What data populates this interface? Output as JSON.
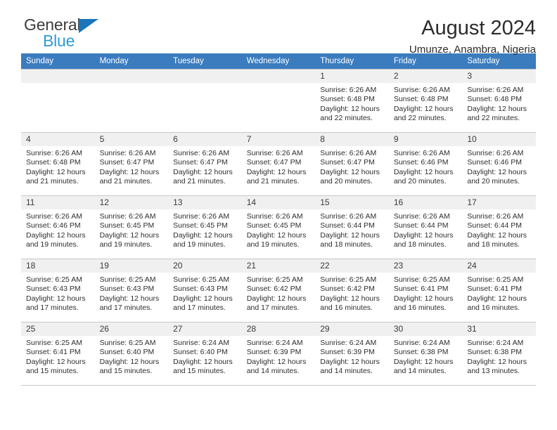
{
  "brand": {
    "name_top": "General",
    "name_bottom": "Blue",
    "accent_color": "#1b75bb",
    "accent_color_light": "#2e9bd6"
  },
  "header": {
    "title": "August 2024",
    "location": "Umunze, Anambra, Nigeria"
  },
  "calendar": {
    "header_bg": "#3b7cbf",
    "header_text_color": "#ffffff",
    "daynum_bg": "#f0f0f0",
    "weekdays": [
      "Sunday",
      "Monday",
      "Tuesday",
      "Wednesday",
      "Thursday",
      "Friday",
      "Saturday"
    ],
    "weeks": [
      [
        {
          "day": "",
          "sunrise": "",
          "sunset": "",
          "daylight_line1": "",
          "daylight_line2": ""
        },
        {
          "day": "",
          "sunrise": "",
          "sunset": "",
          "daylight_line1": "",
          "daylight_line2": ""
        },
        {
          "day": "",
          "sunrise": "",
          "sunset": "",
          "daylight_line1": "",
          "daylight_line2": ""
        },
        {
          "day": "",
          "sunrise": "",
          "sunset": "",
          "daylight_line1": "",
          "daylight_line2": ""
        },
        {
          "day": "1",
          "sunrise": "Sunrise: 6:26 AM",
          "sunset": "Sunset: 6:48 PM",
          "daylight_line1": "Daylight: 12 hours",
          "daylight_line2": "and 22 minutes."
        },
        {
          "day": "2",
          "sunrise": "Sunrise: 6:26 AM",
          "sunset": "Sunset: 6:48 PM",
          "daylight_line1": "Daylight: 12 hours",
          "daylight_line2": "and 22 minutes."
        },
        {
          "day": "3",
          "sunrise": "Sunrise: 6:26 AM",
          "sunset": "Sunset: 6:48 PM",
          "daylight_line1": "Daylight: 12 hours",
          "daylight_line2": "and 22 minutes."
        }
      ],
      [
        {
          "day": "4",
          "sunrise": "Sunrise: 6:26 AM",
          "sunset": "Sunset: 6:48 PM",
          "daylight_line1": "Daylight: 12 hours",
          "daylight_line2": "and 21 minutes."
        },
        {
          "day": "5",
          "sunrise": "Sunrise: 6:26 AM",
          "sunset": "Sunset: 6:47 PM",
          "daylight_line1": "Daylight: 12 hours",
          "daylight_line2": "and 21 minutes."
        },
        {
          "day": "6",
          "sunrise": "Sunrise: 6:26 AM",
          "sunset": "Sunset: 6:47 PM",
          "daylight_line1": "Daylight: 12 hours",
          "daylight_line2": "and 21 minutes."
        },
        {
          "day": "7",
          "sunrise": "Sunrise: 6:26 AM",
          "sunset": "Sunset: 6:47 PM",
          "daylight_line1": "Daylight: 12 hours",
          "daylight_line2": "and 21 minutes."
        },
        {
          "day": "8",
          "sunrise": "Sunrise: 6:26 AM",
          "sunset": "Sunset: 6:47 PM",
          "daylight_line1": "Daylight: 12 hours",
          "daylight_line2": "and 20 minutes."
        },
        {
          "day": "9",
          "sunrise": "Sunrise: 6:26 AM",
          "sunset": "Sunset: 6:46 PM",
          "daylight_line1": "Daylight: 12 hours",
          "daylight_line2": "and 20 minutes."
        },
        {
          "day": "10",
          "sunrise": "Sunrise: 6:26 AM",
          "sunset": "Sunset: 6:46 PM",
          "daylight_line1": "Daylight: 12 hours",
          "daylight_line2": "and 20 minutes."
        }
      ],
      [
        {
          "day": "11",
          "sunrise": "Sunrise: 6:26 AM",
          "sunset": "Sunset: 6:46 PM",
          "daylight_line1": "Daylight: 12 hours",
          "daylight_line2": "and 19 minutes."
        },
        {
          "day": "12",
          "sunrise": "Sunrise: 6:26 AM",
          "sunset": "Sunset: 6:45 PM",
          "daylight_line1": "Daylight: 12 hours",
          "daylight_line2": "and 19 minutes."
        },
        {
          "day": "13",
          "sunrise": "Sunrise: 6:26 AM",
          "sunset": "Sunset: 6:45 PM",
          "daylight_line1": "Daylight: 12 hours",
          "daylight_line2": "and 19 minutes."
        },
        {
          "day": "14",
          "sunrise": "Sunrise: 6:26 AM",
          "sunset": "Sunset: 6:45 PM",
          "daylight_line1": "Daylight: 12 hours",
          "daylight_line2": "and 19 minutes."
        },
        {
          "day": "15",
          "sunrise": "Sunrise: 6:26 AM",
          "sunset": "Sunset: 6:44 PM",
          "daylight_line1": "Daylight: 12 hours",
          "daylight_line2": "and 18 minutes."
        },
        {
          "day": "16",
          "sunrise": "Sunrise: 6:26 AM",
          "sunset": "Sunset: 6:44 PM",
          "daylight_line1": "Daylight: 12 hours",
          "daylight_line2": "and 18 minutes."
        },
        {
          "day": "17",
          "sunrise": "Sunrise: 6:26 AM",
          "sunset": "Sunset: 6:44 PM",
          "daylight_line1": "Daylight: 12 hours",
          "daylight_line2": "and 18 minutes."
        }
      ],
      [
        {
          "day": "18",
          "sunrise": "Sunrise: 6:25 AM",
          "sunset": "Sunset: 6:43 PM",
          "daylight_line1": "Daylight: 12 hours",
          "daylight_line2": "and 17 minutes."
        },
        {
          "day": "19",
          "sunrise": "Sunrise: 6:25 AM",
          "sunset": "Sunset: 6:43 PM",
          "daylight_line1": "Daylight: 12 hours",
          "daylight_line2": "and 17 minutes."
        },
        {
          "day": "20",
          "sunrise": "Sunrise: 6:25 AM",
          "sunset": "Sunset: 6:43 PM",
          "daylight_line1": "Daylight: 12 hours",
          "daylight_line2": "and 17 minutes."
        },
        {
          "day": "21",
          "sunrise": "Sunrise: 6:25 AM",
          "sunset": "Sunset: 6:42 PM",
          "daylight_line1": "Daylight: 12 hours",
          "daylight_line2": "and 17 minutes."
        },
        {
          "day": "22",
          "sunrise": "Sunrise: 6:25 AM",
          "sunset": "Sunset: 6:42 PM",
          "daylight_line1": "Daylight: 12 hours",
          "daylight_line2": "and 16 minutes."
        },
        {
          "day": "23",
          "sunrise": "Sunrise: 6:25 AM",
          "sunset": "Sunset: 6:41 PM",
          "daylight_line1": "Daylight: 12 hours",
          "daylight_line2": "and 16 minutes."
        },
        {
          "day": "24",
          "sunrise": "Sunrise: 6:25 AM",
          "sunset": "Sunset: 6:41 PM",
          "daylight_line1": "Daylight: 12 hours",
          "daylight_line2": "and 16 minutes."
        }
      ],
      [
        {
          "day": "25",
          "sunrise": "Sunrise: 6:25 AM",
          "sunset": "Sunset: 6:41 PM",
          "daylight_line1": "Daylight: 12 hours",
          "daylight_line2": "and 15 minutes."
        },
        {
          "day": "26",
          "sunrise": "Sunrise: 6:25 AM",
          "sunset": "Sunset: 6:40 PM",
          "daylight_line1": "Daylight: 12 hours",
          "daylight_line2": "and 15 minutes."
        },
        {
          "day": "27",
          "sunrise": "Sunrise: 6:24 AM",
          "sunset": "Sunset: 6:40 PM",
          "daylight_line1": "Daylight: 12 hours",
          "daylight_line2": "and 15 minutes."
        },
        {
          "day": "28",
          "sunrise": "Sunrise: 6:24 AM",
          "sunset": "Sunset: 6:39 PM",
          "daylight_line1": "Daylight: 12 hours",
          "daylight_line2": "and 14 minutes."
        },
        {
          "day": "29",
          "sunrise": "Sunrise: 6:24 AM",
          "sunset": "Sunset: 6:39 PM",
          "daylight_line1": "Daylight: 12 hours",
          "daylight_line2": "and 14 minutes."
        },
        {
          "day": "30",
          "sunrise": "Sunrise: 6:24 AM",
          "sunset": "Sunset: 6:38 PM",
          "daylight_line1": "Daylight: 12 hours",
          "daylight_line2": "and 14 minutes."
        },
        {
          "day": "31",
          "sunrise": "Sunrise: 6:24 AM",
          "sunset": "Sunset: 6:38 PM",
          "daylight_line1": "Daylight: 12 hours",
          "daylight_line2": "and 13 minutes."
        }
      ]
    ]
  }
}
